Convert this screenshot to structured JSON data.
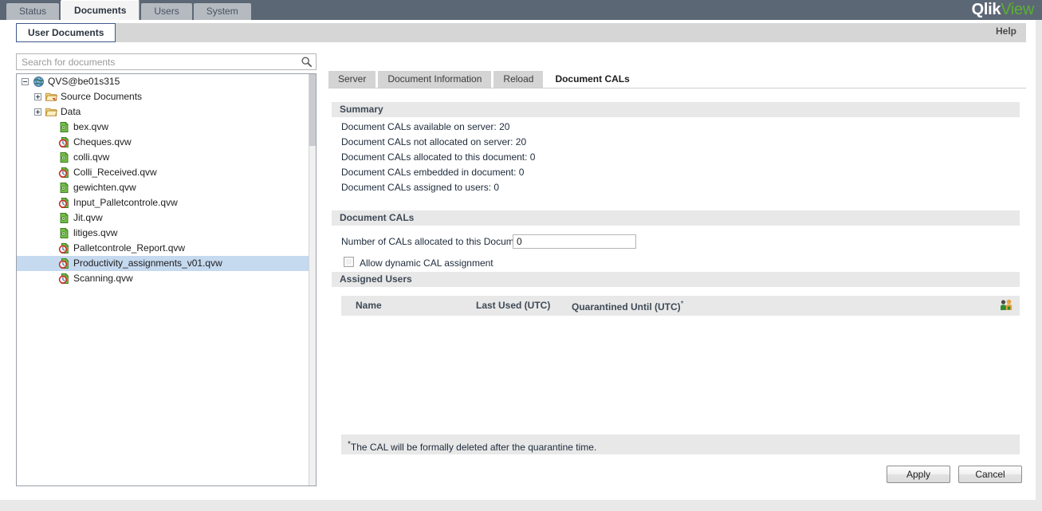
{
  "header": {
    "main_tabs": [
      {
        "label": "Status",
        "active": false
      },
      {
        "label": "Documents",
        "active": true
      },
      {
        "label": "Users",
        "active": false
      },
      {
        "label": "System",
        "active": false
      }
    ],
    "brand_primary": "Qlik",
    "brand_secondary": "View",
    "brand_primary_color": "#ffffff",
    "brand_secondary_color": "#5ab031",
    "bar_color": "#5c6775"
  },
  "subbar": {
    "tab_label": "User Documents",
    "help_label": "Help"
  },
  "search": {
    "placeholder": "Search for documents",
    "value": "",
    "icon": "search-icon"
  },
  "tree": {
    "nodes": [
      {
        "label": "QVS@be01s315",
        "icon": "globe-icon",
        "depth": 0,
        "expander": "minus",
        "selected": false
      },
      {
        "label": "Source Documents",
        "icon": "folder-alert-icon",
        "depth": 1,
        "expander": "plus",
        "selected": false
      },
      {
        "label": "Data",
        "icon": "folder-icon",
        "depth": 1,
        "expander": "plus",
        "selected": false
      },
      {
        "label": "bex.qvw",
        "icon": "document-icon",
        "depth": 2,
        "expander": "none",
        "selected": false
      },
      {
        "label": "Cheques.qvw",
        "icon": "document-scheduled-icon",
        "depth": 2,
        "expander": "none",
        "selected": false
      },
      {
        "label": "colli.qvw",
        "icon": "document-icon",
        "depth": 2,
        "expander": "none",
        "selected": false
      },
      {
        "label": "Colli_Received.qvw",
        "icon": "document-scheduled-icon",
        "depth": 2,
        "expander": "none",
        "selected": false
      },
      {
        "label": "gewichten.qvw",
        "icon": "document-icon",
        "depth": 2,
        "expander": "none",
        "selected": false
      },
      {
        "label": "Input_Palletcontrole.qvw",
        "icon": "document-scheduled-icon",
        "depth": 2,
        "expander": "none",
        "selected": false
      },
      {
        "label": "Jit.qvw",
        "icon": "document-icon",
        "depth": 2,
        "expander": "none",
        "selected": false
      },
      {
        "label": "litiges.qvw",
        "icon": "document-icon",
        "depth": 2,
        "expander": "none",
        "selected": false
      },
      {
        "label": "Palletcontrole_Report.qvw",
        "icon": "document-scheduled-icon",
        "depth": 2,
        "expander": "none",
        "selected": false
      },
      {
        "label": "Productivity_assignments_v01.qvw",
        "icon": "document-scheduled-icon",
        "depth": 2,
        "expander": "none",
        "selected": true
      },
      {
        "label": "Scanning.qvw",
        "icon": "document-scheduled-icon",
        "depth": 2,
        "expander": "none",
        "selected": false
      }
    ],
    "selection_color": "#c5d9ef"
  },
  "content_tabs": [
    {
      "label": "Server",
      "active": false
    },
    {
      "label": "Document Information",
      "active": false
    },
    {
      "label": "Reload",
      "active": false
    },
    {
      "label": "Document CALs",
      "active": true
    }
  ],
  "summary": {
    "heading": "Summary",
    "lines": [
      "Document CALs available on server: 20",
      "Document CALs not allocated on server: 20",
      "Document CALs allocated to this document: 0",
      "Document CALs embedded in document: 0",
      "Document CALs assigned to users: 0"
    ]
  },
  "document_cals": {
    "heading": "Document CALs",
    "number_label": "Number of CALs allocated to this Document:",
    "number_value": "0",
    "dynamic_label": "Allow dynamic CAL assignment",
    "dynamic_checked": false
  },
  "assigned_users": {
    "heading": "Assigned Users",
    "columns": [
      "Name",
      "Last Used (UTC)",
      "Quarantined Until (UTC)"
    ],
    "quarantine_marker": "*",
    "rows": [],
    "add_user_icon": "users-icon"
  },
  "footnote": {
    "marker": "*",
    "text": "The CAL will be formally deleted after the quarantine time."
  },
  "actions": {
    "apply_label": "Apply",
    "cancel_label": "Cancel"
  }
}
